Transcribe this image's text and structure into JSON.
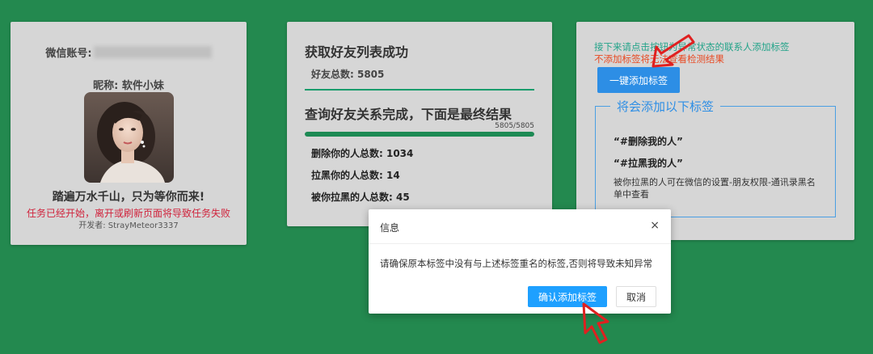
{
  "profile_card": {
    "account_label": "微信账号:",
    "nickname": "昵称: 软件小妹",
    "slogan": "踏遍万水千山，只为等你而来!",
    "warning": "任务已经开始，离开或刷新页面将导致任务失败",
    "developer": "开发者: StrayMeteor3337"
  },
  "result_card": {
    "title_fetch": "获取好友列表成功",
    "total_friends": "好友总数: 5805",
    "title_query": "查询好友关系完成，下面是最终结果",
    "progress_text": "5805/5805",
    "progress": 1.0,
    "stats": [
      "删除你的人总数: 1034",
      "拉黑你的人总数: 14",
      "被你拉黑的人总数: 45"
    ]
  },
  "tag_card": {
    "hint_line1": "接下来请点击按钮为异常状态的联系人添加标签",
    "hint_line2": "不添加标签将无法查看检测结果",
    "button_label": "一键添加标签",
    "legend": "将会添加以下标签",
    "tags": [
      "“#删除我的人”",
      "“#拉黑我的人”"
    ],
    "description": "被你拉黑的人可在微信的设置-朋友权限-通讯录黑名单中查看"
  },
  "modal": {
    "title": "信息",
    "close_symbol": "×",
    "message": "请确保原本标签中没有与上述标签重名的标签,否则将导致未知异常",
    "confirm_label": "确认添加标签",
    "cancel_label": "取消"
  },
  "colors": {
    "background": "#23894f",
    "card": "#d6d6d6",
    "accent_blue": "#2d8ee5",
    "warning_red": "#d0233c",
    "annotation_arrow": "#e02020"
  }
}
